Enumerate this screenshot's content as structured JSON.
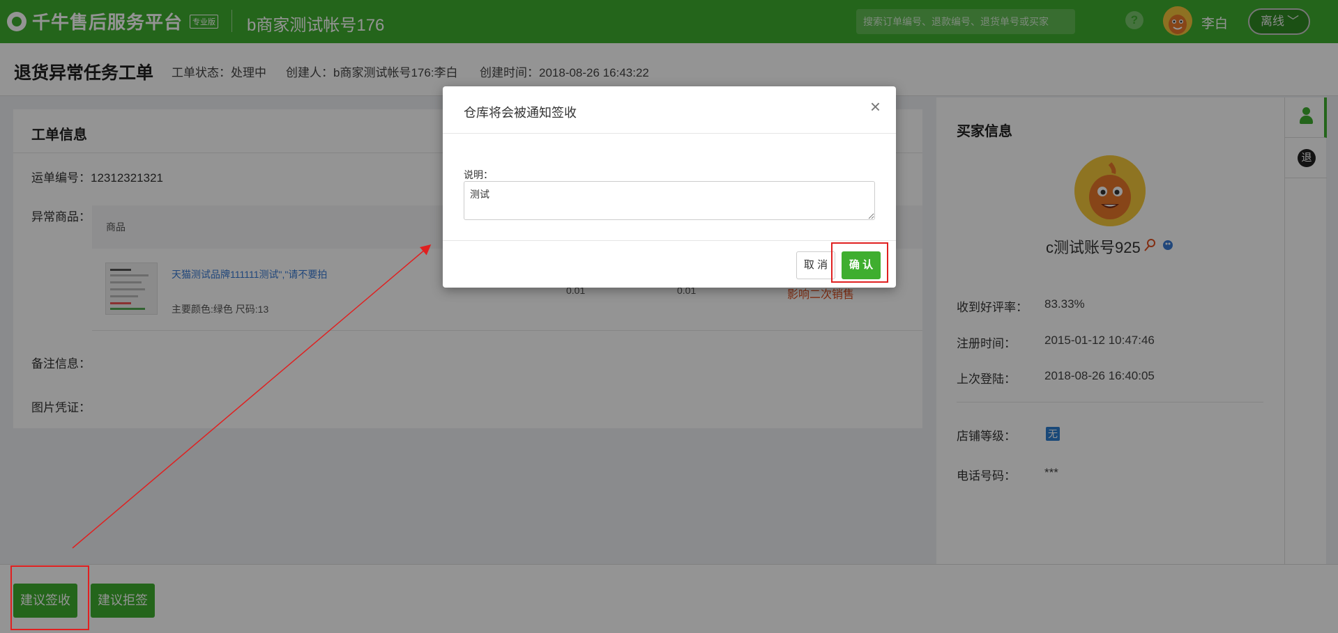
{
  "topbar": {
    "logo_text": "千牛售后服务平台",
    "logo_badge": "专业版",
    "account": "b商家测试帐号176",
    "search_placeholder": "搜索订单编号、退款编号、退货单号或买家",
    "help_icon": "?",
    "username": "李白",
    "status": "离线",
    "status_chevron": "﹀"
  },
  "header": {
    "title": "退货异常任务工单",
    "status": "工单状态：处理中",
    "creator": "创建人：b商家测试帐号176:李白",
    "created_time": "创建时间：2018-08-26 16:43:22"
  },
  "ticket": {
    "title": "工单信息",
    "waybill": "运单编号：12312321321",
    "abnormal_goods_label": "异常商品：",
    "table_header": "商品",
    "product": {
      "name": "天猫测试品牌111111测试\",\"请不要拍",
      "spec": "主要颜色:绿色 尺码:13",
      "price1": "0.01",
      "price2": "0.01",
      "impact": "影响二次销售"
    },
    "remark_label": "备注信息：",
    "image_proof_label": "图片凭证："
  },
  "buyer": {
    "title": "买家信息",
    "name": "c测试账号925",
    "rows": [
      {
        "label": "收到好评率：",
        "value": "83.33%"
      },
      {
        "label": "注册时间：",
        "value": "2015-01-12 10:47:46"
      },
      {
        "label": "上次登陆：",
        "value": "2018-08-26 16:40:05"
      }
    ],
    "shop_level_label": "店铺等级：",
    "shop_level_value": "无",
    "phone_label": "电话号码：",
    "phone_value": "***"
  },
  "side_tabs": {
    "refund_tab": "退"
  },
  "bottom": {
    "suggest_sign": "建议签收",
    "suggest_reject": "建议拒签"
  },
  "modal": {
    "title": "仓库将会被通知签收",
    "close": "×",
    "label": "说明：",
    "textarea_value": "测试",
    "cancel": "取 消",
    "confirm": "确 认"
  },
  "colors": {
    "brand_green": "#3fae2f",
    "annotation_red": "#e02020",
    "link_blue": "#3a7bd5"
  }
}
